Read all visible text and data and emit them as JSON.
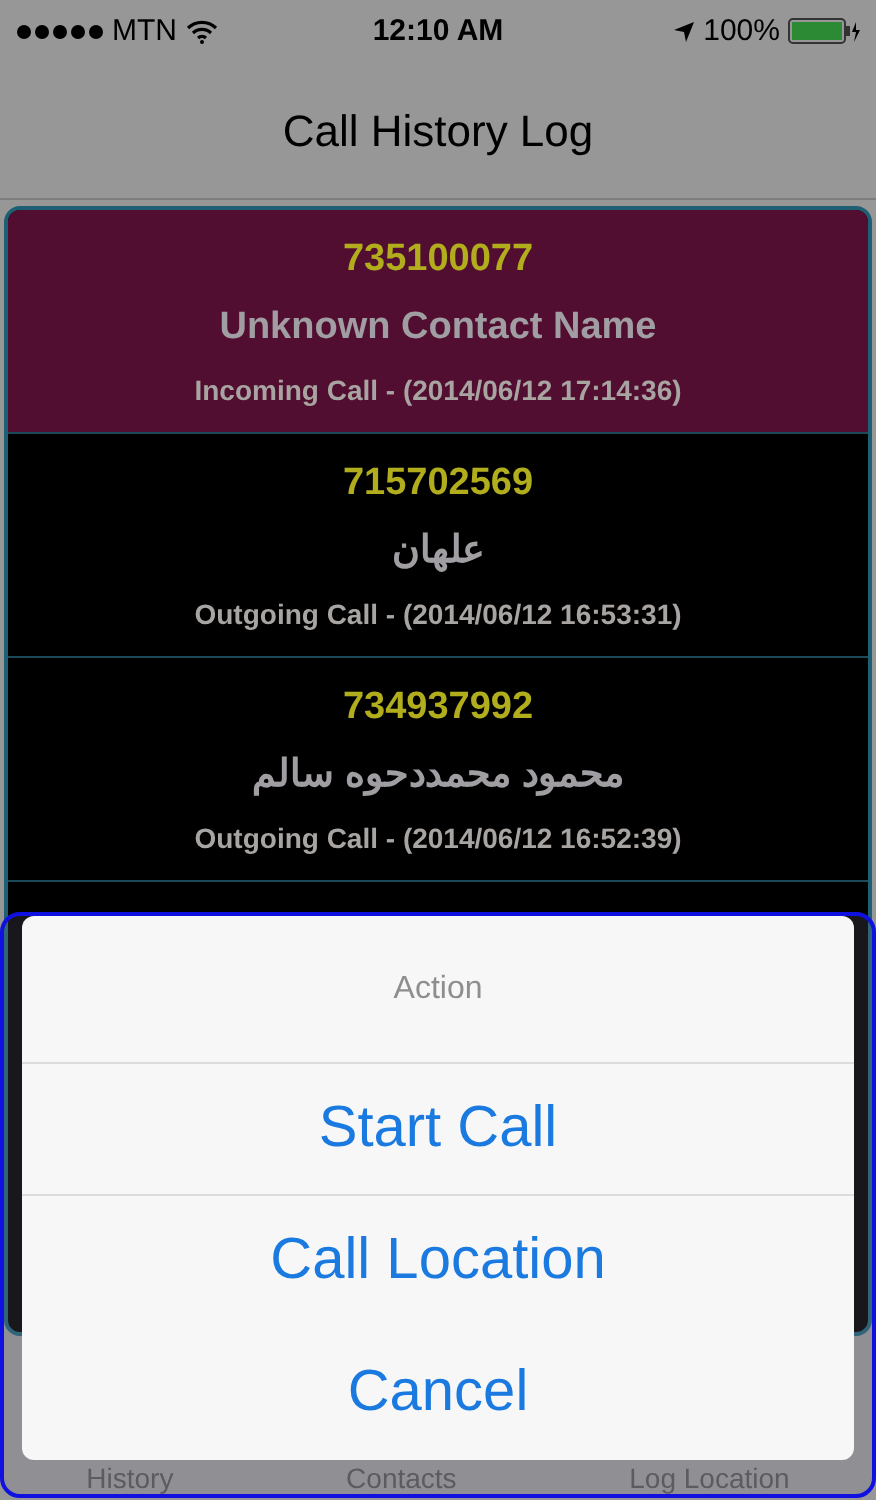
{
  "status_bar": {
    "carrier": "MTN",
    "time": "12:10 AM",
    "battery": "100%"
  },
  "nav_bar": {
    "title": "Call History Log"
  },
  "calls": [
    {
      "number": "735100077",
      "name": "Unknown Contact Name",
      "detail": "Incoming Call - (2014/06/12 17:14:36)",
      "selected": true
    },
    {
      "number": "715702569",
      "name": "علهان",
      "detail": "Outgoing Call - (2014/06/12 16:53:31)",
      "selected": false
    },
    {
      "number": "734937992",
      "name": "محمود محمددحوه سالم",
      "detail": "Outgoing Call - (2014/06/12 16:52:39)",
      "selected": false
    }
  ],
  "tab_bar": [
    "History",
    "Contacts",
    "Log Location"
  ],
  "action_sheet": {
    "title": "Action",
    "buttons": [
      "Start Call",
      "Call Location",
      "Cancel"
    ]
  }
}
